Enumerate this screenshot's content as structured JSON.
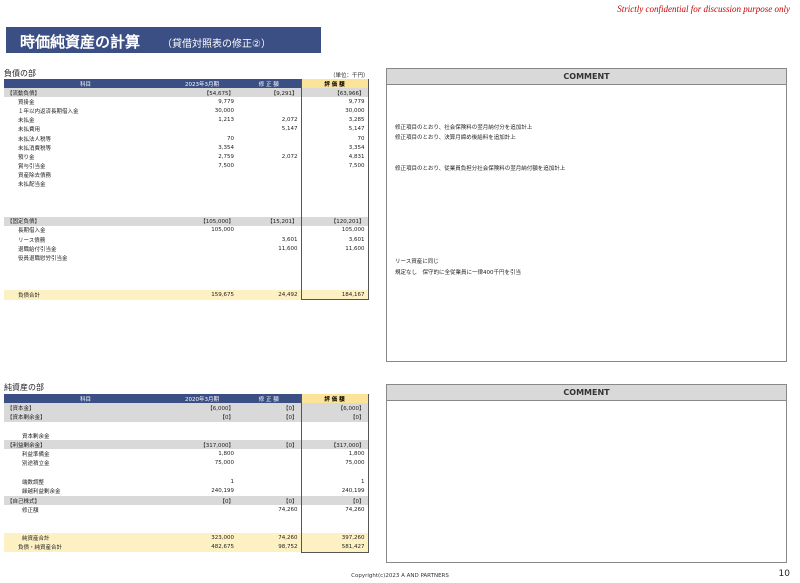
{
  "header": {
    "confidential": "Strictly confidential for discussion purpose only",
    "title": "時価純資産の計算",
    "subtitle": "（貸借対照表の修正②）"
  },
  "liabilities": {
    "section_label": "負債の部",
    "unit": "（単位：千円）",
    "columns": [
      "科目",
      "2023年3月期",
      "修 正 額",
      "評 価 額"
    ],
    "rows": [
      {
        "label": "【流動負債】",
        "v1": "【54,675】",
        "v2": "【9,291】",
        "v3": "【63,966】",
        "type": "grp"
      },
      {
        "label": "買掛金",
        "v1": "9,779",
        "v2": "",
        "v3": "9,779",
        "type": "ind1"
      },
      {
        "label": "１年以内返済長期借入金",
        "v1": "30,000",
        "v2": "",
        "v3": "30,000",
        "type": "ind1"
      },
      {
        "label": "未払金",
        "v1": "1,213",
        "v2": "2,072",
        "v3": "3,285",
        "type": "ind1"
      },
      {
        "label": "未払費用",
        "v1": "",
        "v2": "5,147",
        "v3": "5,147",
        "type": "ind1"
      },
      {
        "label": "未払法人税等",
        "v1": "70",
        "v2": "",
        "v3": "70",
        "type": "ind1"
      },
      {
        "label": "未払消費税等",
        "v1": "3,354",
        "v2": "",
        "v3": "3,354",
        "type": "ind1"
      },
      {
        "label": "預り金",
        "v1": "2,759",
        "v2": "2,072",
        "v3": "4,831",
        "type": "ind1"
      },
      {
        "label": "賞与引当金",
        "v1": "7,500",
        "v2": "",
        "v3": "7,500",
        "type": "ind1"
      },
      {
        "label": "資産除去債務",
        "v1": "",
        "v2": "",
        "v3": "",
        "type": "ind1"
      },
      {
        "label": "未払配当金",
        "v1": "",
        "v2": "",
        "v3": "",
        "type": "ind1"
      },
      {
        "label": "",
        "v1": "",
        "v2": "",
        "v3": "",
        "type": "blank"
      },
      {
        "label": "",
        "v1": "",
        "v2": "",
        "v3": "",
        "type": "blank"
      },
      {
        "label": "",
        "v1": "",
        "v2": "",
        "v3": "",
        "type": "blank"
      },
      {
        "label": "【固定負債】",
        "v1": "【105,000】",
        "v2": "【15,201】",
        "v3": "【120,201】",
        "type": "grp"
      },
      {
        "label": "長期借入金",
        "v1": "105,000",
        "v2": "",
        "v3": "105,000",
        "type": "ind1"
      },
      {
        "label": "リース債務",
        "v1": "",
        "v2": "3,601",
        "v3": "3,601",
        "type": "ind1"
      },
      {
        "label": "退職給付引当金",
        "v1": "",
        "v2": "11,600",
        "v3": "11,600",
        "type": "ind1"
      },
      {
        "label": "役員退職慰労引当金",
        "v1": "",
        "v2": "",
        "v3": "",
        "type": "ind1"
      },
      {
        "label": "",
        "v1": "",
        "v2": "",
        "v3": "",
        "type": "blank"
      },
      {
        "label": "",
        "v1": "",
        "v2": "",
        "v3": "",
        "type": "blank"
      },
      {
        "label": "",
        "v1": "",
        "v2": "",
        "v3": "",
        "type": "blank"
      },
      {
        "label": "負債合計",
        "v1": "159,675",
        "v2": "24,492",
        "v3": "184,167",
        "type": "tot"
      }
    ],
    "comment_header": "COMMENT",
    "comments": [
      "修正項目のとおり、社会保険料の翌月納付分を追加計上",
      "修正項目のとおり、決算月締め後給料を追加計上",
      "修正項目のとおり、従業員負担分社会保険料の翌月納付額を追加計上",
      "リース資産に同じ",
      "規定なし　保守的に全従業員に一律400千円を引当"
    ]
  },
  "equity": {
    "section_label": "純資産の部",
    "columns": [
      "科目",
      "2020年3月期",
      "修 正 額",
      "評 価 額"
    ],
    "rows": [
      {
        "label": "【資本金】",
        "v1": "【6,000】",
        "v2": "【0】",
        "v3": "【6,000】",
        "type": "grp"
      },
      {
        "label": "【資本剰余金】",
        "v1": "【0】",
        "v2": "【0】",
        "v3": "【0】",
        "type": "grp"
      },
      {
        "label": "",
        "v1": "",
        "v2": "",
        "v3": "",
        "type": "blank"
      },
      {
        "label": "資本剰余金",
        "v1": "",
        "v2": "",
        "v3": "",
        "type": "ind2"
      },
      {
        "label": "【利益剰余金】",
        "v1": "【317,000】",
        "v2": "【0】",
        "v3": "【317,000】",
        "type": "grp"
      },
      {
        "label": "利益準備金",
        "v1": "1,800",
        "v2": "",
        "v3": "1,800",
        "type": "ind2"
      },
      {
        "label": "別途積立金",
        "v1": "75,000",
        "v2": "",
        "v3": "75,000",
        "type": "ind2"
      },
      {
        "label": "",
        "v1": "",
        "v2": "",
        "v3": "",
        "type": "blank"
      },
      {
        "label": "端数調整",
        "v1": "1",
        "v2": "",
        "v3": "1",
        "type": "ind2"
      },
      {
        "label": "繰越利益剰余金",
        "v1": "240,199",
        "v2": "",
        "v3": "240,199",
        "type": "ind2"
      },
      {
        "label": "【自己株式】",
        "v1": "【0】",
        "v2": "【0】",
        "v3": "【0】",
        "type": "grp"
      },
      {
        "label": "修正額",
        "v1": "",
        "v2": "74,260",
        "v3": "74,260",
        "type": "ind2"
      },
      {
        "label": "",
        "v1": "",
        "v2": "",
        "v3": "",
        "type": "blank"
      },
      {
        "label": "",
        "v1": "",
        "v2": "",
        "v3": "",
        "type": "blank"
      },
      {
        "label": "純資産合計",
        "v1": "323,000",
        "v2": "74,260",
        "v3": "397,260",
        "type": "tot-ind"
      },
      {
        "label": "負債・純資産合計",
        "v1": "482,675",
        "v2": "98,752",
        "v3": "581,427",
        "type": "tot"
      }
    ],
    "comment_header": "COMMENT"
  },
  "footer": {
    "copyright": "Copyright(c)2023 A AND PARTNERS",
    "page": "10"
  }
}
